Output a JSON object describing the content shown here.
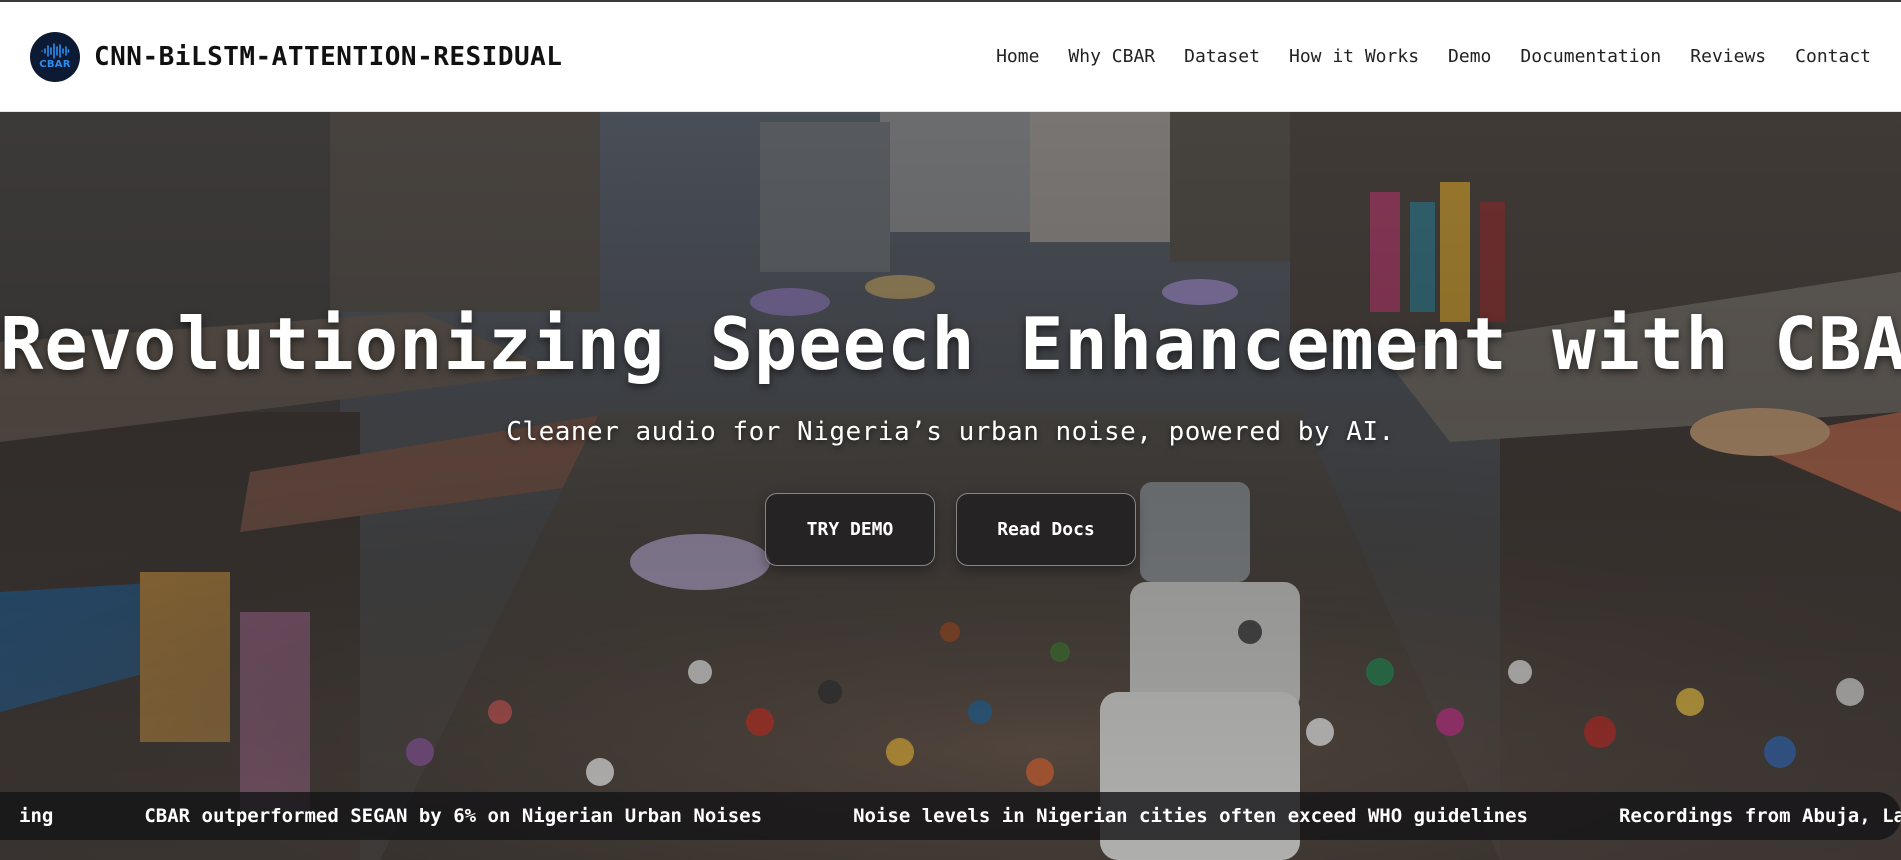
{
  "header": {
    "logo_text": "CBAR",
    "site_title": "CNN-BiLSTM-ATTENTION-RESIDUAL",
    "nav": [
      {
        "label": "Home"
      },
      {
        "label": "Why CBAR"
      },
      {
        "label": "Dataset"
      },
      {
        "label": "How it Works"
      },
      {
        "label": "Demo"
      },
      {
        "label": "Documentation"
      },
      {
        "label": "Reviews"
      },
      {
        "label": "Contact"
      }
    ]
  },
  "hero": {
    "title": "Revolutionizing Speech Enhancement with CBAR",
    "subtitle": "Cleaner audio for Nigeria’s urban noise, powered by AI.",
    "primary_button": "TRY DEMO",
    "secondary_button": "Read Docs",
    "background_image": "busy-nigerian-market-street"
  },
  "ticker": {
    "items": [
      {
        "text": "ing"
      },
      {
        "text_a": "CBAR outperformed SEGAN by ",
        "highlight": "6%",
        "text_b": " on Nigerian Urban Noises"
      },
      {
        "text": "Noise levels in Nigerian cities often exceed WHO guidelines"
      },
      {
        "text_a": "Recordings from ",
        "highlight": "Abuja, Lagos,",
        "text_b": ""
      }
    ]
  },
  "colors": {
    "logo_bg": "#0d1a33",
    "logo_accent": "#2b8df0",
    "button_bg": "#1e1c1e",
    "ticker_bg": "#141416"
  }
}
